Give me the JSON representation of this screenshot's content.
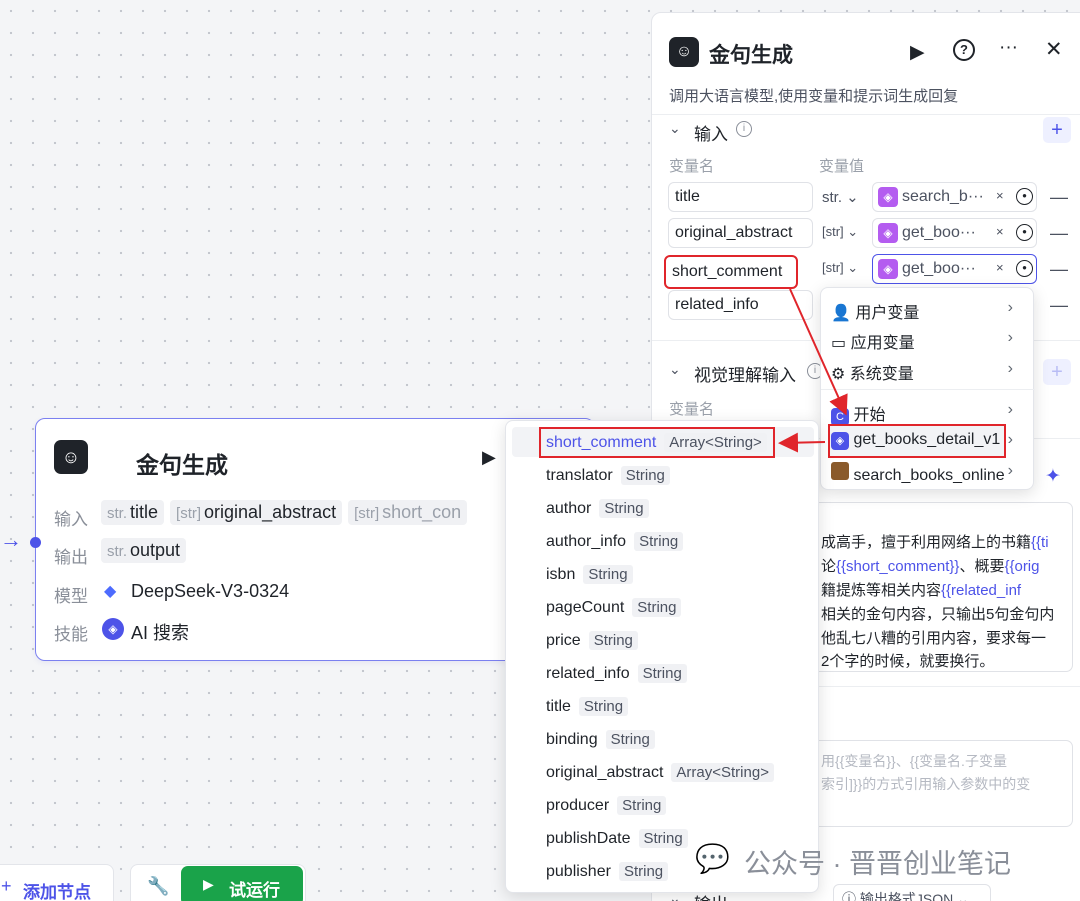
{
  "node": {
    "title": "金句生成",
    "input_label": "输入",
    "output_label": "输出",
    "model_label": "模型",
    "skill_label": "技能",
    "inputs": [
      {
        "type": "str.",
        "name": "title"
      },
      {
        "type": "[str]",
        "name": "original_abstract"
      },
      {
        "type": "[str]",
        "name": "short_con"
      }
    ],
    "output": {
      "type": "str.",
      "name": "output"
    },
    "model": "DeepSeek-V3-0324",
    "skill": "AI 搜索"
  },
  "panel": {
    "title": "金句生成",
    "description": "调用大语言模型,使用变量和提示词生成回复",
    "input_section": "输入",
    "col_name": "变量名",
    "col_value": "变量值",
    "rows": [
      {
        "name": "title",
        "type": "str.",
        "ref": "search_b···"
      },
      {
        "name": "original_abstract",
        "type": "[str]",
        "ref": "get_boo···"
      },
      {
        "name": "short_comment",
        "type": "[str]",
        "ref": "get_boo···"
      },
      {
        "name": "related_info",
        "type": "",
        "ref": ""
      }
    ],
    "vision_section": "视觉理解输入",
    "vision_col_name": "变量名",
    "prompt_lines": [
      [
        "成高手，擅于利用网络上的书籍",
        "{{ti"
      ],
      [
        "论",
        "{{short_comment}}",
        "、概要",
        "{{orig"
      ],
      [
        "籍提炼等相关内容",
        "{{related_inf"
      ],
      [
        "相关的金句内容，只输出5句金句内"
      ],
      [
        "他乱七八糟的引用内容，要求每一"
      ],
      [
        "2个字的时候，就要换行。"
      ]
    ],
    "placeholder_lines": [
      "用{{变量名}}、{{变量名.子变量",
      "索引]}}的方式引用输入参数中的变"
    ],
    "output_section": "输出",
    "output_format": "输出格式JSON"
  },
  "dropdown": {
    "items": [
      {
        "label": "用户变量",
        "icon": "user-icon"
      },
      {
        "label": "应用变量",
        "icon": "folder-icon"
      },
      {
        "label": "系统变量",
        "icon": "gear-icon"
      },
      {
        "label": "开始",
        "icon": "start-icon"
      },
      {
        "label": "get_books_detail_v1",
        "icon": "cube-icon"
      },
      {
        "label": "search_books_online",
        "icon": "book-thumbnail"
      }
    ]
  },
  "field_list": [
    {
      "name": "short_comment",
      "type": "Array<String>"
    },
    {
      "name": "translator",
      "type": "String"
    },
    {
      "name": "author",
      "type": "String"
    },
    {
      "name": "author_info",
      "type": "String"
    },
    {
      "name": "isbn",
      "type": "String"
    },
    {
      "name": "pageCount",
      "type": "String"
    },
    {
      "name": "price",
      "type": "String"
    },
    {
      "name": "related_info",
      "type": "String"
    },
    {
      "name": "title",
      "type": "String"
    },
    {
      "name": "binding",
      "type": "String"
    },
    {
      "name": "original_abstract",
      "type": "Array<String>"
    },
    {
      "name": "producer",
      "type": "String"
    },
    {
      "name": "publishDate",
      "type": "String"
    },
    {
      "name": "publisher",
      "type": "String"
    }
  ],
  "toolbar": {
    "add_node": "添加节点",
    "test_run": "试运行"
  },
  "watermark": "公众号 · 晋晋创业笔记",
  "colors": {
    "accent": "#4d53e8",
    "highlight": "#e0252b",
    "run_button": "#1aa34a",
    "cube": "#b45cf0"
  }
}
